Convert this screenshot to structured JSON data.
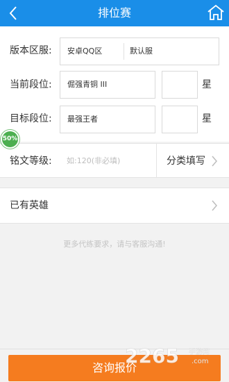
{
  "header": {
    "title": "排位赛",
    "back_icon": "chevron-left-icon",
    "home_icon": "home-icon",
    "bg_color": "#1a8ee8"
  },
  "form": {
    "server": {
      "label": "版本区服:",
      "platform": "安卓QQ区",
      "server": "默认服"
    },
    "current_rank": {
      "label": "当前段位:",
      "value": "倔强青铜 III",
      "stars": "",
      "unit": "星"
    },
    "target_rank": {
      "label": "目标段位:",
      "value": "最强王者",
      "stars": "",
      "unit": "星"
    }
  },
  "mingwen": {
    "label": "铭文等级:",
    "placeholder": "如:120(非必填)",
    "category_label": "分类填写"
  },
  "heroes": {
    "label": "已有英雄"
  },
  "note": "更多代练要求，请与客服沟通!",
  "badge": "50%",
  "primary_button": {
    "label": "咨询报价",
    "color": "#f57c1f"
  },
  "watermark": {
    "brand": "2265",
    "suffix_top": "手游网",
    "suffix_bottom": ".com"
  }
}
